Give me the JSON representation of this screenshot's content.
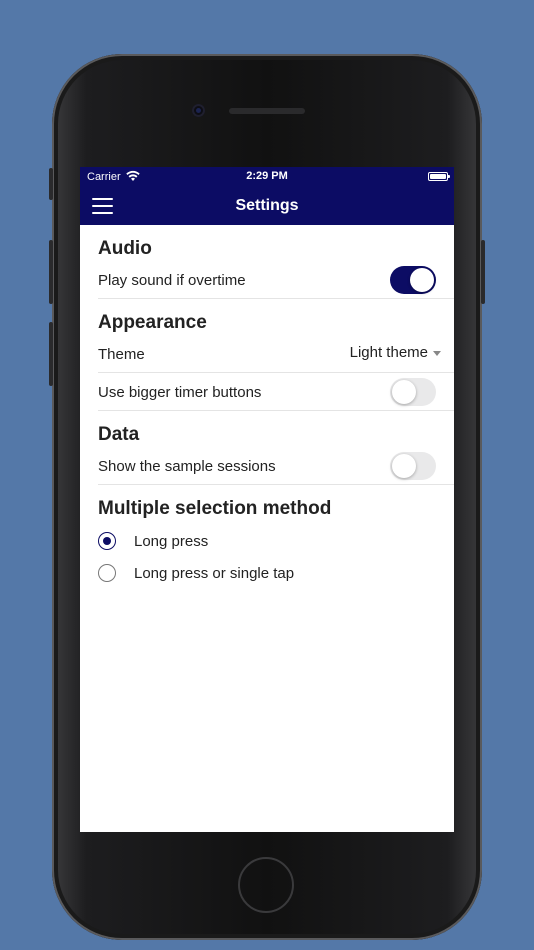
{
  "status": {
    "carrier": "Carrier",
    "time": "2:29 PM"
  },
  "nav": {
    "title": "Settings"
  },
  "audio": {
    "title": "Audio",
    "play_sound_label": "Play sound if overtime",
    "play_sound_on": true
  },
  "appearance": {
    "title": "Appearance",
    "theme_label": "Theme",
    "theme_value": "Light theme",
    "bigger_buttons_label": "Use bigger timer buttons",
    "bigger_buttons_on": false
  },
  "data": {
    "title": "Data",
    "sample_sessions_label": "Show the sample sessions",
    "sample_sessions_on": false
  },
  "selection": {
    "title": "Multiple selection method",
    "options": [
      {
        "label": "Long press",
        "checked": true
      },
      {
        "label": "Long press or single tap",
        "checked": false
      }
    ]
  },
  "colors": {
    "accent": "#0c0c64",
    "background": "#5478a8"
  }
}
